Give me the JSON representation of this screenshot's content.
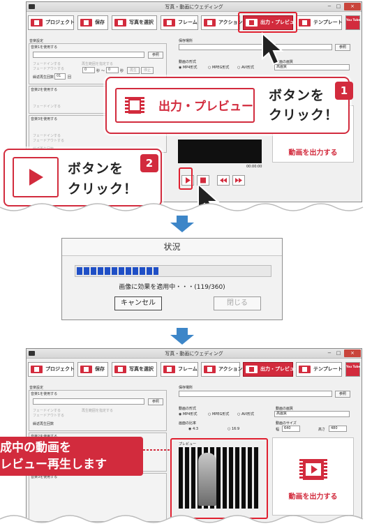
{
  "window": {
    "title": "写真・動画にウェディング",
    "min": "−",
    "max": "□",
    "close": "×"
  },
  "toolbar": {
    "items": [
      {
        "label": "プロジェクト"
      },
      {
        "label": "保存"
      },
      {
        "label": "写真を選択"
      },
      {
        "label": "フレーム"
      },
      {
        "label": "アクション"
      },
      {
        "label": "出力・プレビュー"
      },
      {
        "label": "テンプレート"
      }
    ],
    "youtube": "You Tube"
  },
  "left_panel": {
    "title": "音楽設定",
    "use_music": "音楽1を使用する",
    "use_music_2": "音楽2を使用する",
    "use_music_3": "音楽3を使用する",
    "ref_button": "参照",
    "fade_in": "フェードインする",
    "fade_out": "フェードアウトする",
    "play_range": "再生範囲を指定する",
    "repeat": "繰返再生回数",
    "repeat_value": "01",
    "times": "回",
    "sec_from": "0",
    "sec_to": "0",
    "sec": "秒",
    "tilde": "〜",
    "play": "再生",
    "stop": "停止"
  },
  "right_panel": {
    "save_location": "保存場所",
    "ref_button": "参照",
    "format_label": "動画の形式",
    "formats": [
      "MP4形式",
      "MPEG形式",
      "AVI形式"
    ],
    "quality_label": "動画の画質",
    "quality_value": "高画質",
    "ratio_label": "画面の比率",
    "ratios": [
      "4:3",
      "16:9"
    ],
    "size_label": "動画のサイズ",
    "width_label": "幅",
    "width_value": "640",
    "height_label": "高さ",
    "height_value": "480",
    "preview_label": "プレビュー",
    "time": "00:00:00",
    "output_button": "動画を出力する"
  },
  "callout1": {
    "number": "1",
    "button_label": "出力・プレビュー",
    "line1": "ボタンを",
    "line2": "クリック！"
  },
  "callout2": {
    "number": "2",
    "line1": "ボタンを",
    "line2": "クリック！"
  },
  "dialog": {
    "title": "状況",
    "progress": 0.42,
    "message": "画像に効果を適用中・・・(119/360)",
    "cancel": "キャンセル",
    "close": "閉じる"
  },
  "caption": {
    "line1": "成中の動画を",
    "line2": "レビュー再生します"
  },
  "colors": {
    "accent": "#d22b3d",
    "progress": "#1f4fc6",
    "arrow": "#3d86c8"
  }
}
